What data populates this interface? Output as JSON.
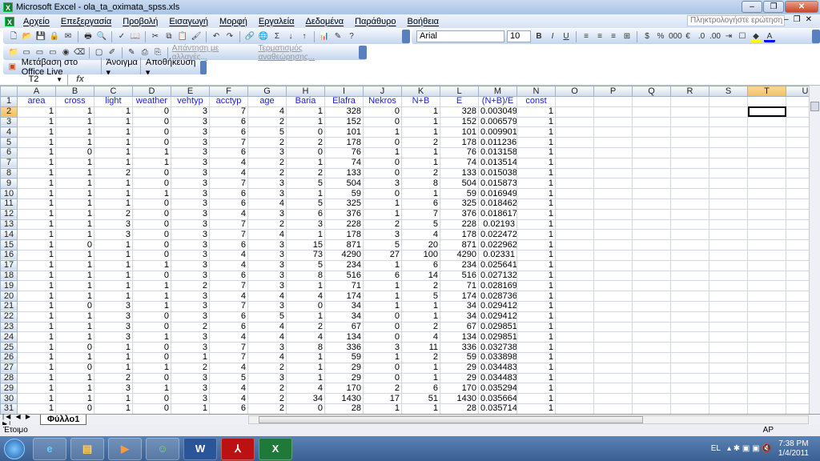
{
  "window": {
    "title": "Microsoft Excel - ola_ta_oximata_spss.xls",
    "app_icon": "excel-icon"
  },
  "menu": [
    "Αρχείο",
    "Επεξεργασία",
    "Προβολή",
    "Εισαγωγή",
    "Μορφή",
    "Εργαλεία",
    "Δεδομένα",
    "Παράθυρο",
    "Βοήθεια"
  ],
  "help_placeholder": "Πληκτρολογήστε ερώτηση",
  "formatting": {
    "font": "Arial",
    "size": "10",
    "bold": "B",
    "italic": "I",
    "underline": "U",
    "currency": "$",
    "percent": "%",
    "thousands": "000",
    "euro": "€"
  },
  "review_toolbar": {
    "reply": "Απάντηση με αλλαγές...",
    "end_review": "Τερματισμός αναθεώρησης..."
  },
  "office_live": {
    "goto": "Μετάβαση στο Office Live",
    "open": "Άνοιγμα",
    "save": "Αποθήκευση"
  },
  "formula_bar": {
    "name_box": "T2",
    "fx": "fx",
    "value": ""
  },
  "grid": {
    "columns": [
      "A",
      "B",
      "C",
      "D",
      "E",
      "F",
      "G",
      "H",
      "I",
      "J",
      "K",
      "L",
      "M",
      "N",
      "O",
      "P",
      "Q",
      "R",
      "S",
      "T",
      "U"
    ],
    "selected_cell": "T2",
    "headers": [
      "area",
      "cross",
      "light",
      "weather",
      "vehtyp",
      "acctyp",
      "age",
      "Baria",
      "Elafra",
      "Nekros",
      "N+B",
      "E",
      "(N+B)/E",
      "const"
    ],
    "rows": [
      [
        1,
        1,
        1,
        0,
        3,
        7,
        4,
        1,
        328,
        0,
        1,
        328,
        "0.003049",
        1
      ],
      [
        1,
        1,
        1,
        0,
        3,
        6,
        2,
        1,
        152,
        0,
        1,
        152,
        "0.006579",
        1
      ],
      [
        1,
        1,
        1,
        0,
        3,
        6,
        5,
        0,
        101,
        1,
        1,
        101,
        "0.009901",
        1
      ],
      [
        1,
        1,
        1,
        0,
        3,
        7,
        2,
        2,
        178,
        0,
        2,
        178,
        "0.011236",
        1
      ],
      [
        1,
        0,
        1,
        1,
        3,
        6,
        3,
        0,
        76,
        1,
        1,
        76,
        "0.013158",
        1
      ],
      [
        1,
        1,
        1,
        1,
        3,
        4,
        2,
        1,
        74,
        0,
        1,
        74,
        "0.013514",
        1
      ],
      [
        1,
        1,
        2,
        0,
        3,
        4,
        2,
        2,
        133,
        0,
        2,
        133,
        "0.015038",
        1
      ],
      [
        1,
        1,
        1,
        0,
        3,
        7,
        3,
        5,
        504,
        3,
        8,
        504,
        "0.015873",
        1
      ],
      [
        1,
        1,
        1,
        1,
        3,
        6,
        3,
        1,
        59,
        0,
        1,
        59,
        "0.016949",
        1
      ],
      [
        1,
        1,
        1,
        0,
        3,
        6,
        4,
        5,
        325,
        1,
        6,
        325,
        "0.018462",
        1
      ],
      [
        1,
        1,
        2,
        0,
        3,
        4,
        3,
        6,
        376,
        1,
        7,
        376,
        "0.018617",
        1
      ],
      [
        1,
        1,
        3,
        0,
        3,
        7,
        2,
        3,
        228,
        2,
        5,
        228,
        "0.02193",
        1
      ],
      [
        1,
        1,
        3,
        0,
        3,
        7,
        4,
        1,
        178,
        3,
        4,
        178,
        "0.022472",
        1
      ],
      [
        1,
        0,
        1,
        0,
        3,
        6,
        3,
        15,
        871,
        5,
        20,
        871,
        "0.022962",
        1
      ],
      [
        1,
        1,
        1,
        0,
        3,
        4,
        3,
        73,
        4290,
        27,
        100,
        4290,
        "0.02331",
        1
      ],
      [
        1,
        1,
        1,
        1,
        3,
        4,
        3,
        5,
        234,
        1,
        6,
        234,
        "0.025641",
        1
      ],
      [
        1,
        1,
        1,
        0,
        3,
        6,
        3,
        8,
        516,
        6,
        14,
        516,
        "0.027132",
        1
      ],
      [
        1,
        1,
        1,
        1,
        2,
        7,
        3,
        1,
        71,
        1,
        2,
        71,
        "0.028169",
        1
      ],
      [
        1,
        1,
        1,
        1,
        3,
        4,
        4,
        4,
        174,
        1,
        5,
        174,
        "0.028736",
        1
      ],
      [
        1,
        0,
        3,
        1,
        3,
        7,
        3,
        0,
        34,
        1,
        1,
        34,
        "0.029412",
        1
      ],
      [
        1,
        1,
        3,
        0,
        3,
        6,
        5,
        1,
        34,
        0,
        1,
        34,
        "0.029412",
        1
      ],
      [
        1,
        1,
        3,
        0,
        2,
        6,
        4,
        2,
        67,
        0,
        2,
        67,
        "0.029851",
        1
      ],
      [
        1,
        1,
        3,
        1,
        3,
        4,
        4,
        4,
        134,
        0,
        4,
        134,
        "0.029851",
        1
      ],
      [
        1,
        0,
        1,
        0,
        3,
        7,
        3,
        8,
        336,
        3,
        11,
        336,
        "0.032738",
        1
      ],
      [
        1,
        1,
        1,
        0,
        1,
        7,
        4,
        1,
        59,
        1,
        2,
        59,
        "0.033898",
        1
      ],
      [
        1,
        0,
        1,
        1,
        2,
        4,
        2,
        1,
        29,
        0,
        1,
        29,
        "0.034483",
        1
      ],
      [
        1,
        1,
        2,
        0,
        3,
        5,
        3,
        1,
        29,
        0,
        1,
        29,
        "0.034483",
        1
      ],
      [
        1,
        1,
        3,
        1,
        3,
        4,
        2,
        4,
        170,
        2,
        6,
        170,
        "0.035294",
        1
      ],
      [
        1,
        1,
        1,
        0,
        3,
        4,
        2,
        34,
        1430,
        17,
        51,
        1430,
        "0.035664",
        1
      ],
      [
        1,
        0,
        1,
        0,
        1,
        6,
        2,
        0,
        28,
        1,
        1,
        28,
        "0.035714",
        1
      ]
    ]
  },
  "sheet_tabs": [
    "Φύλλο1"
  ],
  "status": {
    "text": "Έτοιμο",
    "indicator": "ΑΡ"
  },
  "taskbar": {
    "apps": [
      "internet-explorer",
      "explorer",
      "media-player",
      "messenger",
      "word",
      "acrobat",
      "excel"
    ],
    "language": "EL",
    "time": "7:38 PM",
    "date": "1/4/2011"
  },
  "colors": {
    "header_text": "#1c1cd8",
    "selected_header": "#f1c15f",
    "taskbar": "#3b5f92"
  }
}
